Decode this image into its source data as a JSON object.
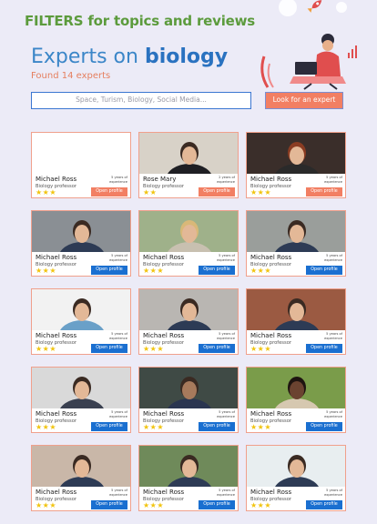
{
  "header": {
    "filters_title": "FILTERS for topics and reviews",
    "hero_prefix": "Experts on ",
    "hero_highlight": "biology",
    "found_text": "Found 14 experts"
  },
  "search": {
    "placeholder": "Space, Turism, Biology, Social Media...",
    "button_label": "Look for an expert"
  },
  "colors": {
    "accent_orange": "#f27f63",
    "accent_blue": "#1a6fd0",
    "title_green": "#5c9b3d"
  },
  "cards": [
    {
      "name": "Michael Ross",
      "role": "Biology professor",
      "exp_line1": "5 years of",
      "exp_line2": "experience",
      "rating": 3,
      "button": "Open profile",
      "button_style": "orange",
      "photo": "blank"
    },
    {
      "name": "Rose Mary",
      "role": "Biology professor",
      "exp_line1": "2 years of",
      "exp_line2": "experience",
      "rating": 2,
      "button": "Open profile",
      "button_style": "orange",
      "photo": "woman-dark-top"
    },
    {
      "name": "Michael Ross",
      "role": "Biology professor",
      "exp_line1": "5 years of",
      "exp_line2": "experience",
      "rating": 3,
      "button": "Open profile",
      "button_style": "orange",
      "photo": "woman-red-hair"
    },
    {
      "name": "Michael Ross",
      "role": "Biology professor",
      "exp_line1": "5 years of",
      "exp_line2": "experience",
      "rating": 3,
      "button": "Open profile",
      "button_style": "blue",
      "photo": "woman-hair"
    },
    {
      "name": "Michael Ross",
      "role": "Biology professor",
      "exp_line1": "5 years of",
      "exp_line2": "experience",
      "rating": 3,
      "button": "Open profile",
      "button_style": "blue",
      "photo": "woman-blonde"
    },
    {
      "name": "Michael Ross",
      "role": "Biology professor",
      "exp_line1": "5 years of",
      "exp_line2": "experience",
      "rating": 3,
      "button": "Open profile",
      "button_style": "blue",
      "photo": "man-beard"
    },
    {
      "name": "Michael Ross",
      "role": "Biology professor",
      "exp_line1": "5 years of",
      "exp_line2": "experience",
      "rating": 3,
      "button": "Open profile",
      "button_style": "blue",
      "photo": "man-glasses-white"
    },
    {
      "name": "Michael Ross",
      "role": "Biology professor",
      "exp_line1": "5 years of",
      "exp_line2": "experience",
      "rating": 3,
      "button": "Open profile",
      "button_style": "blue",
      "photo": "man-gray"
    },
    {
      "name": "Michael Ross",
      "role": "Biology professor",
      "exp_line1": "5 years of",
      "exp_line2": "experience",
      "rating": 3,
      "button": "Open profile",
      "button_style": "blue",
      "photo": "man-brick"
    },
    {
      "name": "Michael Ross",
      "role": "Biology professor",
      "exp_line1": "5 years of",
      "exp_line2": "experience",
      "rating": 3,
      "button": "Open profile",
      "button_style": "blue",
      "photo": "man-tablet"
    },
    {
      "name": "Michael Ross",
      "role": "Biology professor",
      "exp_line1": "5 years of",
      "exp_line2": "experience",
      "rating": 3,
      "button": "Open profile",
      "button_style": "blue",
      "photo": "man-smile"
    },
    {
      "name": "Michael Ross",
      "role": "Biology professor",
      "exp_line1": "5 years of",
      "exp_line2": "experience",
      "rating": 3,
      "button": "Open profile",
      "button_style": "blue",
      "photo": "woman-curly"
    },
    {
      "name": "Michael Ross",
      "role": "Biology professor",
      "exp_line1": "5 years of",
      "exp_line2": "experience",
      "rating": 3,
      "button": "Open profile",
      "button_style": "blue",
      "photo": "woman-laptop"
    },
    {
      "name": "Michael Ross",
      "role": "Biology professor",
      "exp_line1": "5 years of",
      "exp_line2": "experience",
      "rating": 3,
      "button": "Open profile",
      "button_style": "blue",
      "photo": "man-outdoor"
    },
    {
      "name": "Michael Ross",
      "role": "Biology professor",
      "exp_line1": "5 years of",
      "exp_line2": "experience",
      "rating": 3,
      "button": "Open profile",
      "button_style": "blue",
      "photo": "woman-lab"
    }
  ]
}
